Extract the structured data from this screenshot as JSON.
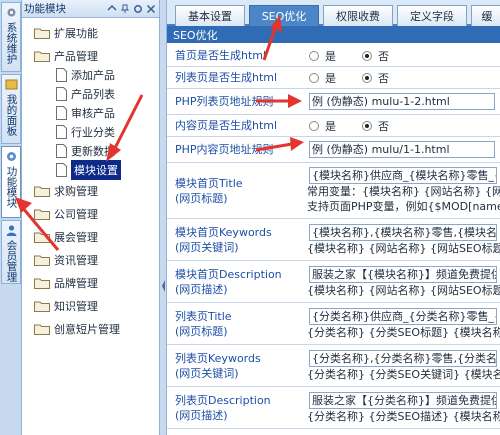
{
  "vtabs": [
    {
      "label": "系统维护"
    },
    {
      "label": "我的面板"
    },
    {
      "label": "功能模块"
    },
    {
      "label": "会员管理"
    }
  ],
  "tree": {
    "title": "功能模块",
    "items": [
      {
        "label": "扩展功能"
      },
      {
        "label": "产品管理"
      },
      {
        "label": "添加产品"
      },
      {
        "label": "产品列表"
      },
      {
        "label": "审核产品"
      },
      {
        "label": "行业分类"
      },
      {
        "label": "更新数据"
      },
      {
        "label": "模块设置"
      },
      {
        "label": "求购管理"
      },
      {
        "label": "公司管理"
      },
      {
        "label": "展会管理"
      },
      {
        "label": "资讯管理"
      },
      {
        "label": "品牌管理"
      },
      {
        "label": "知识管理"
      },
      {
        "label": "创意短片管理"
      }
    ]
  },
  "tabs": [
    {
      "label": "基本设置"
    },
    {
      "label": "SEO优化"
    },
    {
      "label": "权限收费"
    },
    {
      "label": "定义字段"
    },
    {
      "label": "缓"
    }
  ],
  "section_title": "SEO优化",
  "radio": {
    "yes": "是",
    "no": "否"
  },
  "rows": [
    {
      "label": "首页是否生成html"
    },
    {
      "label": "列表页是否生成html"
    },
    {
      "label": "PHP列表页地址规则",
      "value": "例 (伪静态) mulu-1-2.html"
    },
    {
      "label": "内容页是否生成html"
    },
    {
      "label": "PHP内容页地址规则",
      "value": "例 (伪静态) mulu/1-1.html"
    },
    {
      "label": "模块首页Title",
      "sub": "(网页标题)",
      "lines": [
        "{模块名称}供应商_{模块名称}零售_{",
        "常用变量：{模块名称} {网站名称} {网",
        "支持页面PHP变量，例如{$MOD[name]"
      ]
    },
    {
      "label": "模块首页Keywords",
      "sub": "(网页关键词)",
      "lines": [
        "{模块名称},{模块名称}零售,{模块名称}",
        "{模块名称} {网站名称} {网站SEO标题"
      ]
    },
    {
      "label": "模块首页Description",
      "sub": "(网页描述)",
      "lines": [
        "服装之家【{模块名称}】频道免费提供各",
        "{模块名称} {网站名称} {网站SEO标题"
      ]
    },
    {
      "label": "列表页Title",
      "sub": "(网页标题)",
      "lines": [
        "{分类名称}供应商_{分类名称}零售_{分",
        "{分类名称} {分类SEO标题} {模块名称"
      ]
    },
    {
      "label": "列表页Keywords",
      "sub": "(网页关键词)",
      "lines": [
        "{分类名称},{分类名称}零售,{分类名称}",
        "{分类名称} {分类SEO关键词} {模块名"
      ]
    },
    {
      "label": "列表页Description",
      "sub": "(网页描述)",
      "lines": [
        "服装之家【{分类名称}】频道免费提供各",
        "{分类名称} {分类SEO描述} {模块名称"
      ]
    }
  ],
  "colors": {
    "accent": "#2f6cb5",
    "arrow": "#e3342f",
    "selection": "#0d2a8a"
  }
}
